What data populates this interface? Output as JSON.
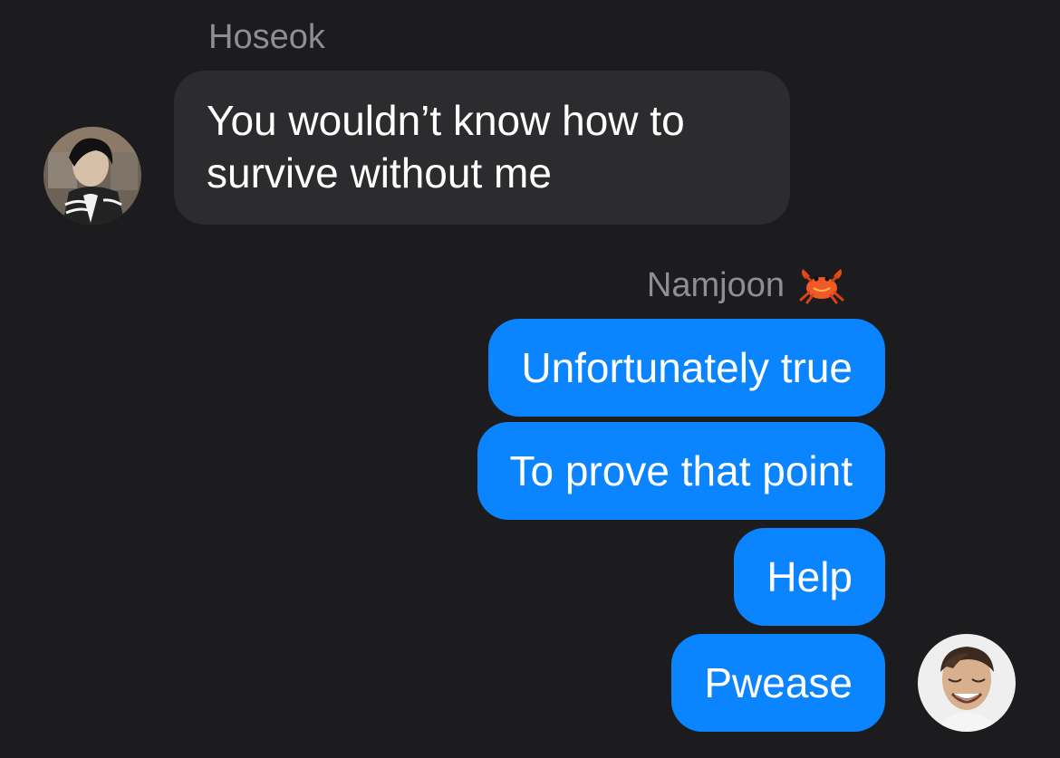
{
  "conversation": {
    "incoming": {
      "sender": "Hoseok",
      "avatar": "avatar-hoseok",
      "message": "You wouldn’t know how to survive without me"
    },
    "outgoing": {
      "sender": "Namjoon",
      "sender_emoji_icon": "crab-icon",
      "avatar": "avatar-namjoon",
      "messages": [
        "Unfortunately true",
        "To prove that point",
        "Help",
        "Pwease"
      ]
    }
  },
  "colors": {
    "background": "#1c1c1e",
    "incoming_bubble": "#2c2c2e",
    "outgoing_bubble": "#0a84ff",
    "sender_name": "#8e8e93",
    "message_text": "#ffffff"
  }
}
